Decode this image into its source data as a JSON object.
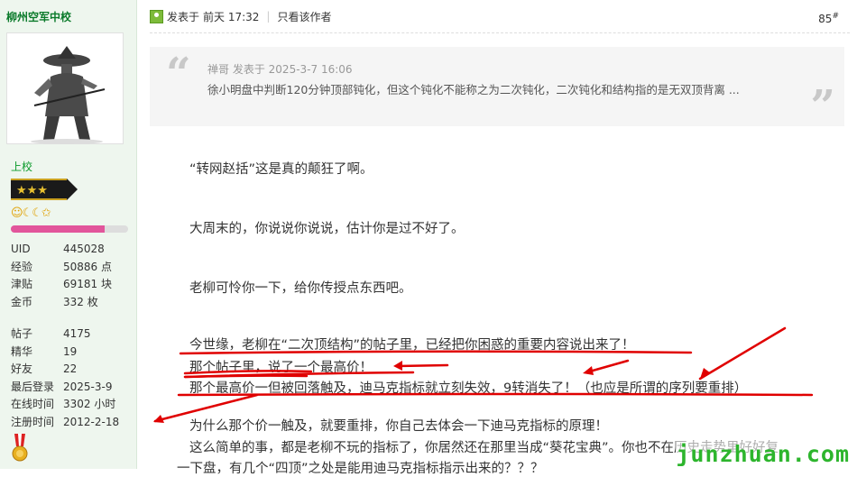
{
  "user": {
    "name": "柳州空军中校",
    "rank": "上校",
    "stats": [
      {
        "k": "UID",
        "v": "445028"
      },
      {
        "k": "经验",
        "v": "50886 点"
      },
      {
        "k": "津贴",
        "v": "69181 块"
      },
      {
        "k": "金币",
        "v": "332 枚"
      }
    ],
    "stats2": [
      {
        "k": "帖子",
        "v": "4175"
      },
      {
        "k": "精华",
        "v": "19"
      },
      {
        "k": "好友",
        "v": "22"
      },
      {
        "k": "最后登录",
        "v": "2025-3-9"
      },
      {
        "k": "在线时间",
        "v": "3302 小时"
      },
      {
        "k": "注册时间",
        "v": "2012-2-18"
      }
    ],
    "level_progress": 0.8,
    "medals_icons": "☺☾☾✩"
  },
  "post": {
    "posted_prefix": "发表于",
    "posted_time": "前天 17:32",
    "only_author": "只看该作者",
    "floor": "85",
    "floor_mark": "#"
  },
  "quote": {
    "author": "禅哥",
    "posted": "发表于 2025-3-7 16:06",
    "text": "徐小明盘中判断120分钟顶部钝化，但这个钝化不能称之为二次钝化，二次钝化和结构指的是无双顶背离 ..."
  },
  "content": {
    "p1": "“转网赵括”这是真的颠狂了啊。",
    "p2": "大周末的，你说说你说说，估计你是过不好了。",
    "p3": "老柳可怜你一下，给你传授点东西吧。",
    "p4": "今世缘，老柳在“二次顶结构”的帖子里，已经把你困惑的重要内容说出来了！",
    "p5": "那个帖子里，说了一个最高价！",
    "p6": "那个最高价一但被回落触及，迪马克指标就立刻失效，9转消失了！（也应是所谓的序列要重排）",
    "p7": "为什么那个价一触及，就要重排，你自己去体会一下迪马克指标的原理！",
    "p8": "这么简单的事，都是老柳不玩的指标了，你居然还在那里当成“葵花宝典”。你也不在历史走势里好好复",
    "p9": "一下盘，有几个“四顶”之处是能用迪马克指标指示出来的？？？"
  },
  "watermark": "junzhuan.com",
  "colors": {
    "annotation": "#e00000",
    "username": "#0a7a2a",
    "progress": "#e2559b",
    "watermark": "#2db52d"
  }
}
